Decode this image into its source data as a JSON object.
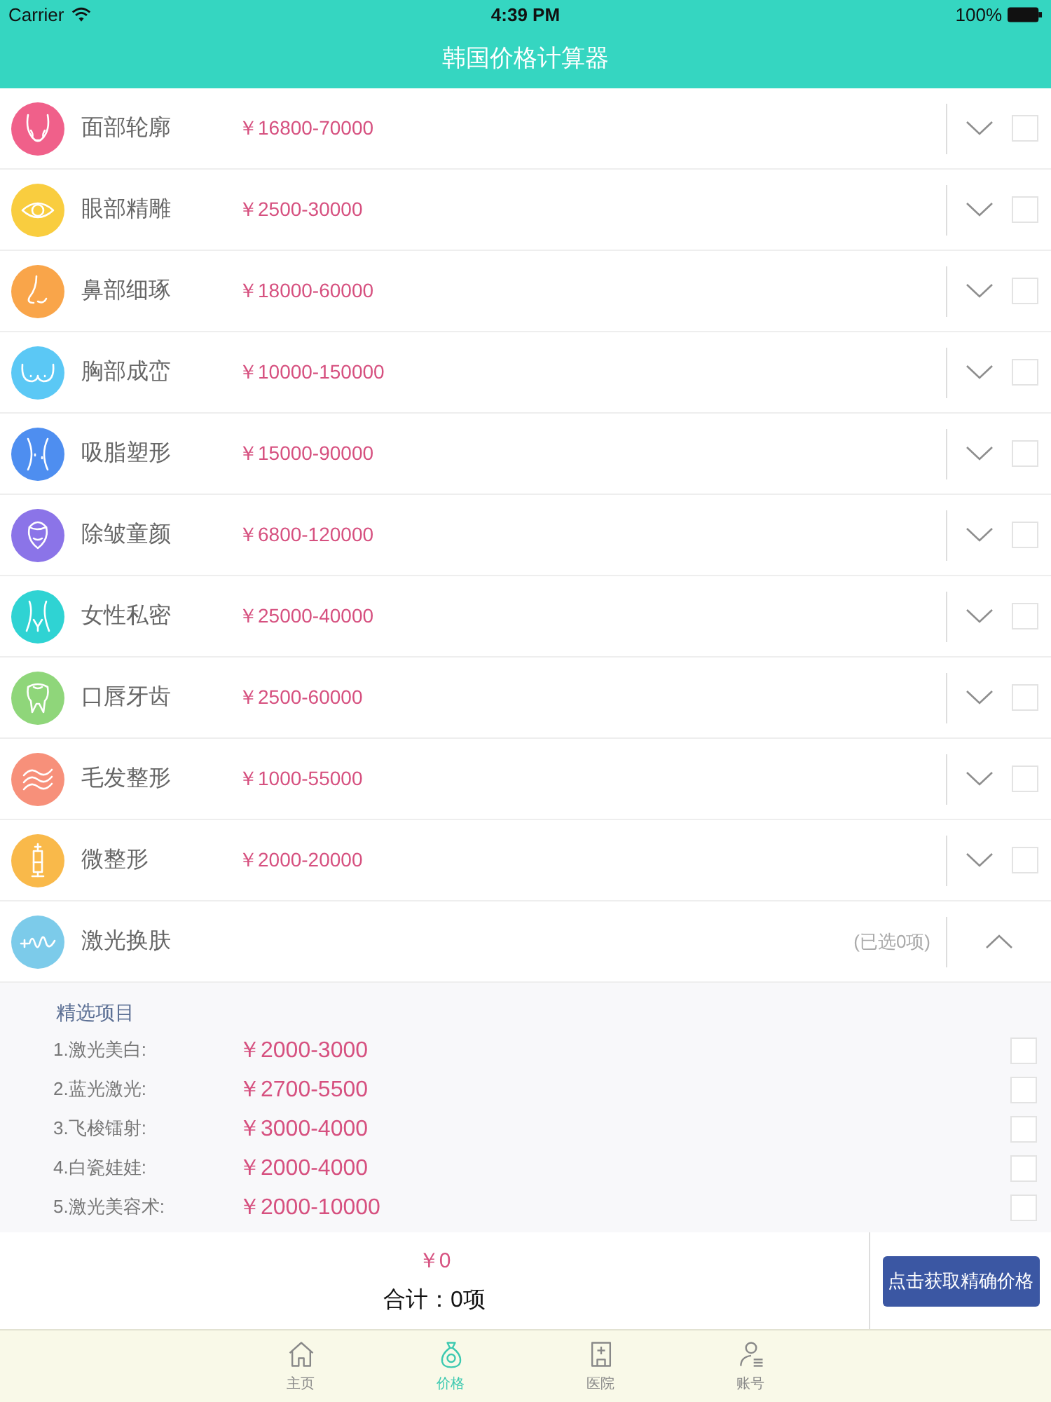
{
  "status_bar": {
    "carrier": "Carrier",
    "time": "4:39 PM",
    "battery": "100%"
  },
  "header": {
    "title": "韩国价格计算器"
  },
  "categories": [
    {
      "name": "面部轮廓",
      "price": "￥16800-70000",
      "color": "#f0608a",
      "expanded": false,
      "checked": false
    },
    {
      "name": "眼部精雕",
      "price": "￥2500-30000",
      "color": "#f9cd3f",
      "expanded": false,
      "checked": false
    },
    {
      "name": "鼻部细琢",
      "price": "￥18000-60000",
      "color": "#f9a54a",
      "expanded": false,
      "checked": false
    },
    {
      "name": "胸部成峦",
      "price": "￥10000-150000",
      "color": "#5bc8f5",
      "expanded": false,
      "checked": false
    },
    {
      "name": "吸脂塑形",
      "price": "￥15000-90000",
      "color": "#4e8ef0",
      "expanded": false,
      "checked": false
    },
    {
      "name": "除皱童颜",
      "price": "￥6800-120000",
      "color": "#8b74e8",
      "expanded": false,
      "checked": false
    },
    {
      "name": "女性私密",
      "price": "￥25000-40000",
      "color": "#2fd3d3",
      "expanded": false,
      "checked": false
    },
    {
      "name": "口唇牙齿",
      "price": "￥2500-60000",
      "color": "#8fd67a",
      "expanded": false,
      "checked": false
    },
    {
      "name": "毛发整形",
      "price": "￥1000-55000",
      "color": "#f7907a",
      "expanded": false,
      "checked": false
    },
    {
      "name": "微整形",
      "price": "￥2000-20000",
      "color": "#f9b94a",
      "expanded": false,
      "checked": false
    },
    {
      "name": "激光换肤",
      "selected_count": "(已选0项)",
      "color": "#7ccbea",
      "expanded": true,
      "options_title": "精选项目",
      "options": [
        {
          "label": "1.激光美白:",
          "price": "￥2000-3000",
          "checked": false
        },
        {
          "label": "2.蓝光激光:",
          "price": "￥2700-5500",
          "checked": false
        },
        {
          "label": "3.飞梭镭射:",
          "price": "￥3000-4000",
          "checked": false
        },
        {
          "label": "4.白瓷娃娃:",
          "price": "￥2000-4000",
          "checked": false
        },
        {
          "label": "5.激光美容术:",
          "price": "￥2000-10000",
          "checked": false
        }
      ]
    }
  ],
  "summary": {
    "total": "￥0",
    "count": "合计：0项",
    "button": "点击获取精确价格"
  },
  "tab_bar": [
    {
      "label": "主页",
      "selected": false
    },
    {
      "label": "价格",
      "selected": true
    },
    {
      "label": "医院",
      "selected": false
    },
    {
      "label": "账号",
      "selected": false
    }
  ]
}
